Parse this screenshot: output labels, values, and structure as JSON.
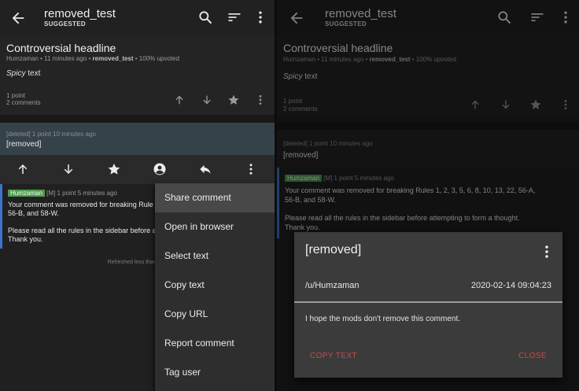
{
  "toolbar": {
    "title": "removed_test",
    "subtitle": "SUGGESTED"
  },
  "post": {
    "title": "Controversial headline",
    "author": "Humzaman",
    "time": "11 minutes ago",
    "subreddit": "removed_test",
    "upvoted": "100% upvoted",
    "body_italic": "Spicy",
    "body_rest": " text",
    "points": "1 point",
    "comments": "2 comments"
  },
  "deleted_comment": {
    "meta": "[deleted] 1 point 10 minutes ago",
    "body": "[removed]"
  },
  "my_comment": {
    "flair": "Humzaman",
    "meta": "[M] 1 point 5 minutes ago",
    "line1_left": "Your comment was removed for breaking Rule",
    "line2_left": "56-B, and 58-W.",
    "line3_left": "Please read all the rules in the sidebar before a",
    "line4_left": "Thank you.",
    "line1_right": "Your comment was removed for breaking Rules 1, 2, 3, 5, 6, 8, 10, 13, 22, 56-A,",
    "line2_right": "56-B, and 58-W.",
    "line3_right": "Please read all the rules in the sidebar before attempting to form a thought.",
    "line4_right": "Thank you."
  },
  "refreshed": "Refreshed less than a m",
  "menu": {
    "items": [
      "Share comment",
      "Open in browser",
      "Select text",
      "Copy text",
      "Copy URL",
      "Report comment",
      "Tag user"
    ]
  },
  "dialog": {
    "title": "[removed]",
    "user": "/u/Humzaman",
    "date": "2020-02-14 09:04:23",
    "text": "I hope the mods don't remove this comment.",
    "copy_label": "COPY TEXT",
    "close_label": "CLOSE"
  },
  "icons": {
    "back": "arrow-left-icon",
    "search": "search-icon",
    "sort": "sort-icon",
    "more": "more-vert-icon",
    "upvote": "arrow-up-icon",
    "downvote": "arrow-down-icon",
    "save": "star-icon",
    "profile": "account-circle-icon",
    "reply": "reply-icon"
  },
  "colors": {
    "flair": "#4f9a4f",
    "accent_bar": "#3d73c8",
    "dialog_buttons": "#c94a4a",
    "highlight": "#484848"
  }
}
